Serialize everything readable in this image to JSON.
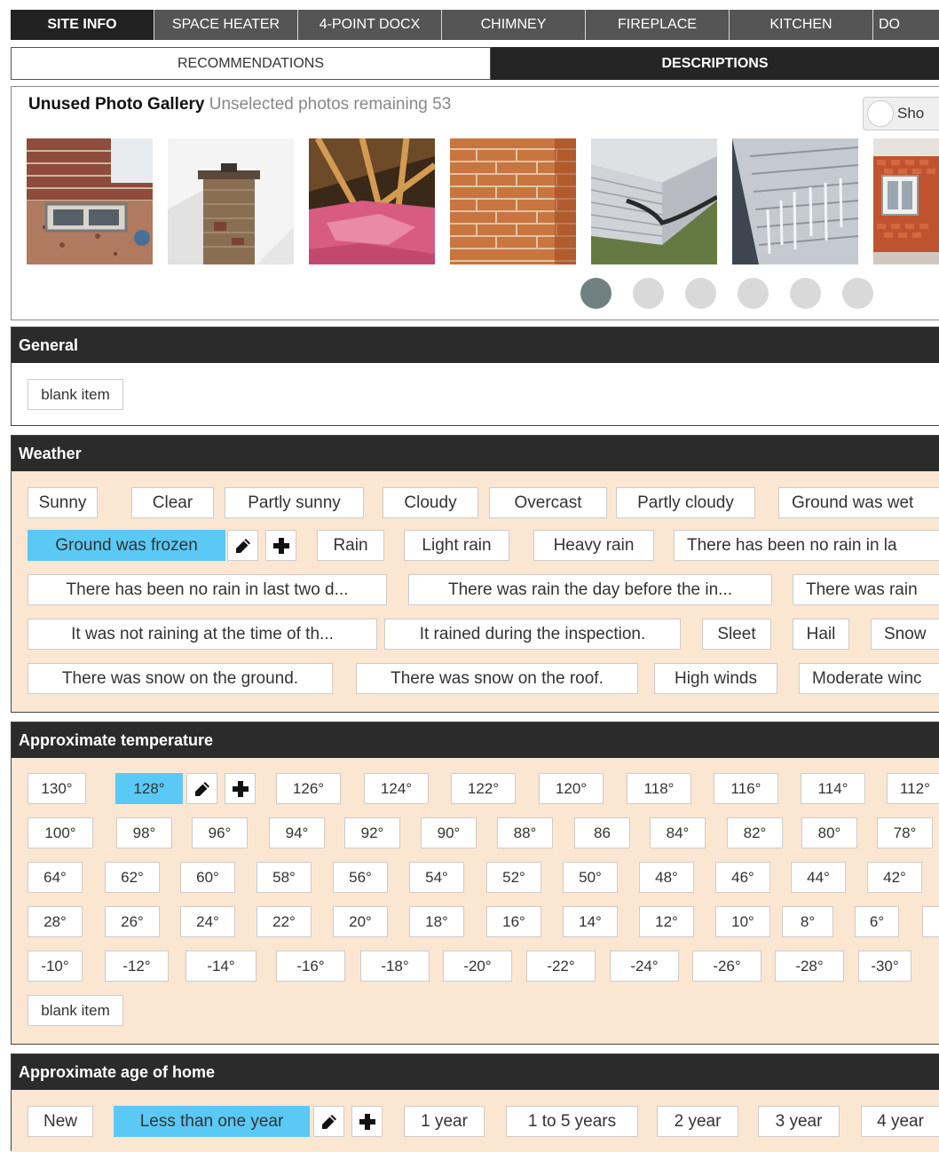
{
  "tabs": [
    "SITE INFO",
    "SPACE HEATER",
    "4-POINT DOCX",
    "CHIMNEY",
    "FIREPLACE",
    "KITCHEN",
    "DO"
  ],
  "subtabs": {
    "recommendations": "RECOMMENDATIONS",
    "descriptions": "DESCRIPTIONS"
  },
  "gallery": {
    "title": "Unused Photo Gallery",
    "subtitle": "Unselected photos remaining 53",
    "show_label": "Sho",
    "photos": [
      "basement-window-photo",
      "chimney-photo",
      "attic-insulation-photo",
      "brick-wall-photo",
      "siding-corner-photo",
      "icicles-siding-photo",
      "brick-bay-photo"
    ],
    "pages": 6,
    "active_page": 1
  },
  "general": {
    "title": "General",
    "items": [
      "blank item"
    ]
  },
  "weather": {
    "title": "Weather",
    "items": [
      "Sunny",
      "Clear",
      "Partly sunny",
      "Cloudy",
      "Overcast",
      "Partly cloudy",
      "Ground was wet",
      "Ground was frozen",
      "Rain",
      "Light rain",
      "Heavy rain",
      "There has been no rain in la",
      "There has been no rain in last two d...",
      "There was rain the day before the in...",
      "There was rain",
      "It was not raining at the time of th...",
      "It rained during the inspection.",
      "Sleet",
      "Hail",
      "Snow",
      "There was snow on the ground.",
      "There was snow on the roof.",
      "High winds",
      "Moderate winc"
    ],
    "selected": "Ground was frozen"
  },
  "temperature": {
    "title": "Approximate temperature",
    "items": [
      "130°",
      "128°",
      "126°",
      "124°",
      "122°",
      "120°",
      "118°",
      "116°",
      "114°",
      "112°",
      "100°",
      "98°",
      "96°",
      "94°",
      "92°",
      "90°",
      "88°",
      "86",
      "84°",
      "82°",
      "80°",
      "78°",
      "64°",
      "62°",
      "60°",
      "58°",
      "56°",
      "54°",
      "52°",
      "50°",
      "48°",
      "46°",
      "44°",
      "42°",
      "28°",
      "26°",
      "24°",
      "22°",
      "20°",
      "18°",
      "16°",
      "14°",
      "12°",
      "10°",
      "8°",
      "6°",
      "-10°",
      "-12°",
      "-14°",
      "-16°",
      "-18°",
      "-20°",
      "-22°",
      "-24°",
      "-26°",
      "-28°",
      "-30°",
      "blank item"
    ],
    "selected": "128°"
  },
  "age": {
    "title": "Approximate age of home",
    "items": [
      "New",
      "Less than one year",
      "1 year",
      "1 to 5 years",
      "2 year",
      "3 year",
      "4 year"
    ],
    "selected": "Less than one year"
  },
  "colors": {
    "selected": "#5bc9f5",
    "chip_area": "#fbe6d2",
    "header": "#2b2b2b",
    "dot_active": "#6f8180"
  }
}
